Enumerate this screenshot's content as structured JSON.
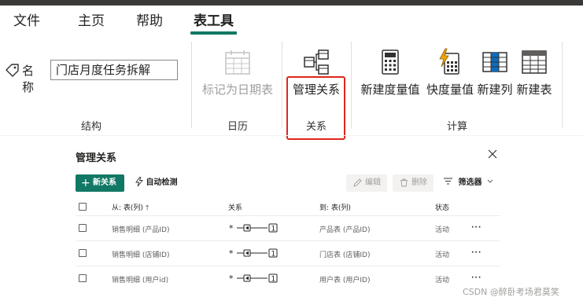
{
  "menu": {
    "file": "文件",
    "home": "主页",
    "help": "帮助",
    "table_tools": "表工具"
  },
  "ribbon": {
    "name_label": "名称",
    "name_value": "门店月度任务拆解",
    "mark_date_table": "标记为日期表",
    "manage_relationships": "管理关系",
    "new_measure": "新建度量值",
    "quick_measure": "快度量值",
    "new_column": "新建列",
    "new_table": "新建表",
    "groups": {
      "structure": "结构",
      "calendar": "日历",
      "relationships": "关系",
      "calculations": "计算"
    }
  },
  "dialog": {
    "title": "管理关系",
    "new_relationship": "新关系",
    "auto_detect": "自动检测",
    "edit": "编辑",
    "delete": "删除",
    "filter": "筛选器",
    "columns": {
      "from": "从: 表(列)",
      "relationship": "关系",
      "to": "到: 表(列)",
      "state": "状态"
    },
    "rows": [
      {
        "from": "销售明细 (产品ID)",
        "cardinality_from": "*",
        "cardinality_to": "1",
        "to": "产品表 (产品ID)",
        "state": "活动",
        "more": "···"
      },
      {
        "from": "销售明细 (店铺ID)",
        "cardinality_from": "*",
        "cardinality_to": "1",
        "to": "门店表 (店铺ID)",
        "state": "活动",
        "more": "···"
      },
      {
        "from": "销售明细 (用户id)",
        "cardinality_from": "*",
        "cardinality_to": "1",
        "to": "用户表 (用户ID)",
        "state": "活动",
        "more": "···"
      }
    ]
  },
  "watermark": "CSDN @醉卧考场君莫笑",
  "colors": {
    "accent": "#117865",
    "highlight": "#e0261c",
    "disabled": "#a19f9d"
  }
}
